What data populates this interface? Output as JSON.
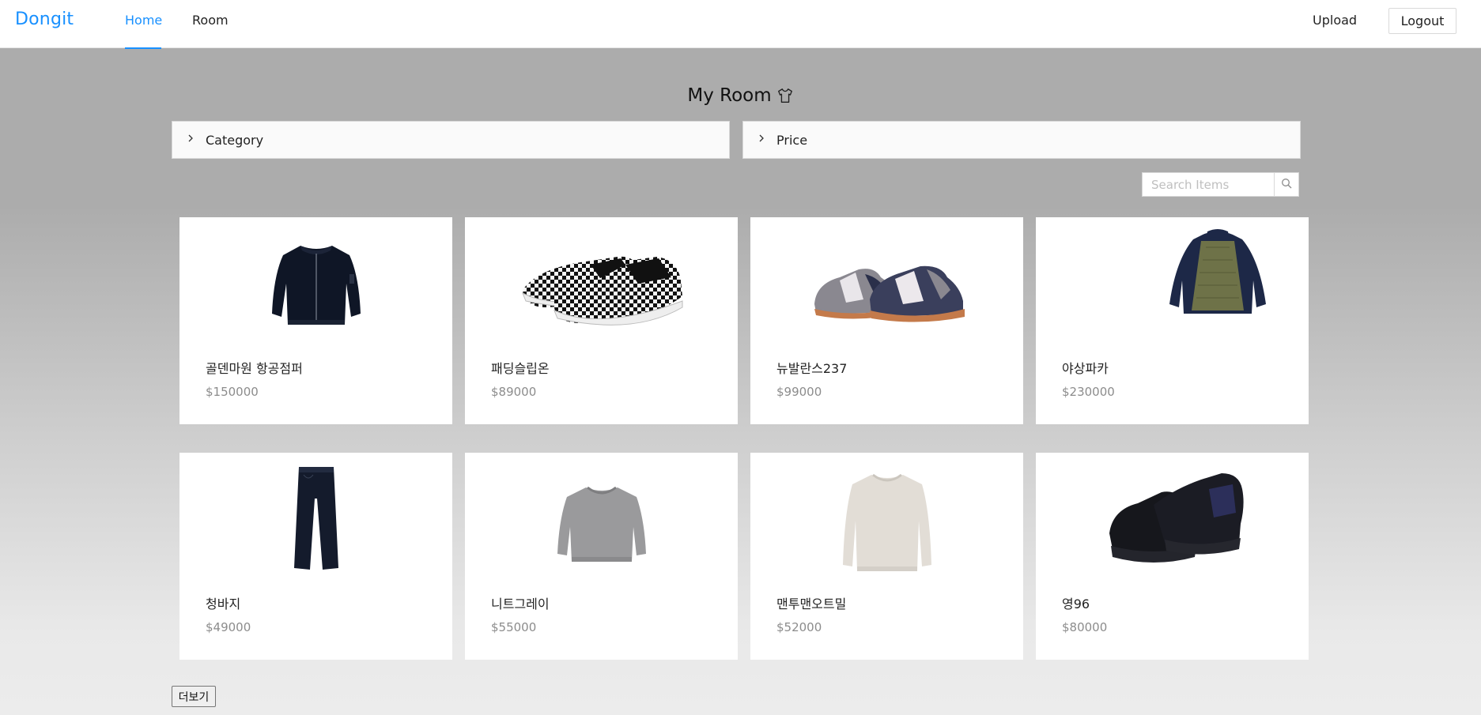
{
  "navbar": {
    "brand": "Dongit",
    "links": [
      "Home",
      "Room"
    ],
    "upload_label": "Upload",
    "logout_label": "Logout",
    "accent_color": "#1890ff"
  },
  "main": {
    "title": "My Room",
    "title_icon": "shirt-icon",
    "filters": {
      "category_label": "Category",
      "price_label": "Price"
    },
    "search": {
      "placeholder": "Search Items",
      "icon": "search-icon"
    },
    "products": [
      {
        "name": "골덴마원 항공점퍼",
        "price": "$150000",
        "image": "black-bomber-jacket"
      },
      {
        "name": "패딩슬립온",
        "price": "$89000",
        "image": "checkered-slip-on-shoes"
      },
      {
        "name": "뉴발란스237",
        "price": "$99000",
        "image": "grey-navy-sneakers"
      },
      {
        "name": "야상파카",
        "price": "$230000",
        "image": "navy-parka-khaki-lining"
      },
      {
        "name": "청바지",
        "price": "$49000",
        "image": "dark-denim-jeans"
      },
      {
        "name": "니트그레이",
        "price": "$55000",
        "image": "grey-knit-sweater"
      },
      {
        "name": "맨투맨오트밀",
        "price": "$52000",
        "image": "oatmeal-sweatshirt"
      },
      {
        "name": "영96",
        "price": "$80000",
        "image": "black-chunky-sneakers"
      }
    ],
    "more_label": "더보기"
  }
}
